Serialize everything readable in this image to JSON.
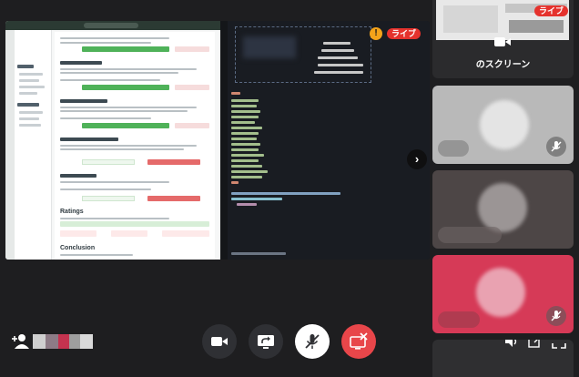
{
  "main_stage": {
    "live_label": "ライブ",
    "warning_symbol": "!",
    "next_symbol": "›",
    "shared_document": {
      "section_title_ratings": "Ratings",
      "section_title_conclusion": "Conclusion"
    }
  },
  "participants": {
    "screen_tile": {
      "label": "のスクリーン",
      "live_label": "ライブ"
    },
    "tiles": [
      {
        "kind": "participant",
        "muted": true,
        "color": "#b9b9b9"
      },
      {
        "kind": "participant",
        "muted": false,
        "color": "#4d4646"
      },
      {
        "kind": "participant",
        "muted": true,
        "color": "#d63a57"
      },
      {
        "kind": "participant",
        "muted": false,
        "color": "#2f2f31"
      }
    ]
  },
  "controls": {
    "buttons": [
      "camera",
      "share-screen",
      "microphone-muted",
      "leave-call"
    ],
    "leave_color": "#e8464a"
  },
  "utility": [
    "volume",
    "pop-out",
    "fullscreen"
  ],
  "colors": {
    "background": "#1e1e20",
    "live_red": "#e5322d",
    "warning_orange": "#f4a31a",
    "approve_green": "#4fb259"
  }
}
